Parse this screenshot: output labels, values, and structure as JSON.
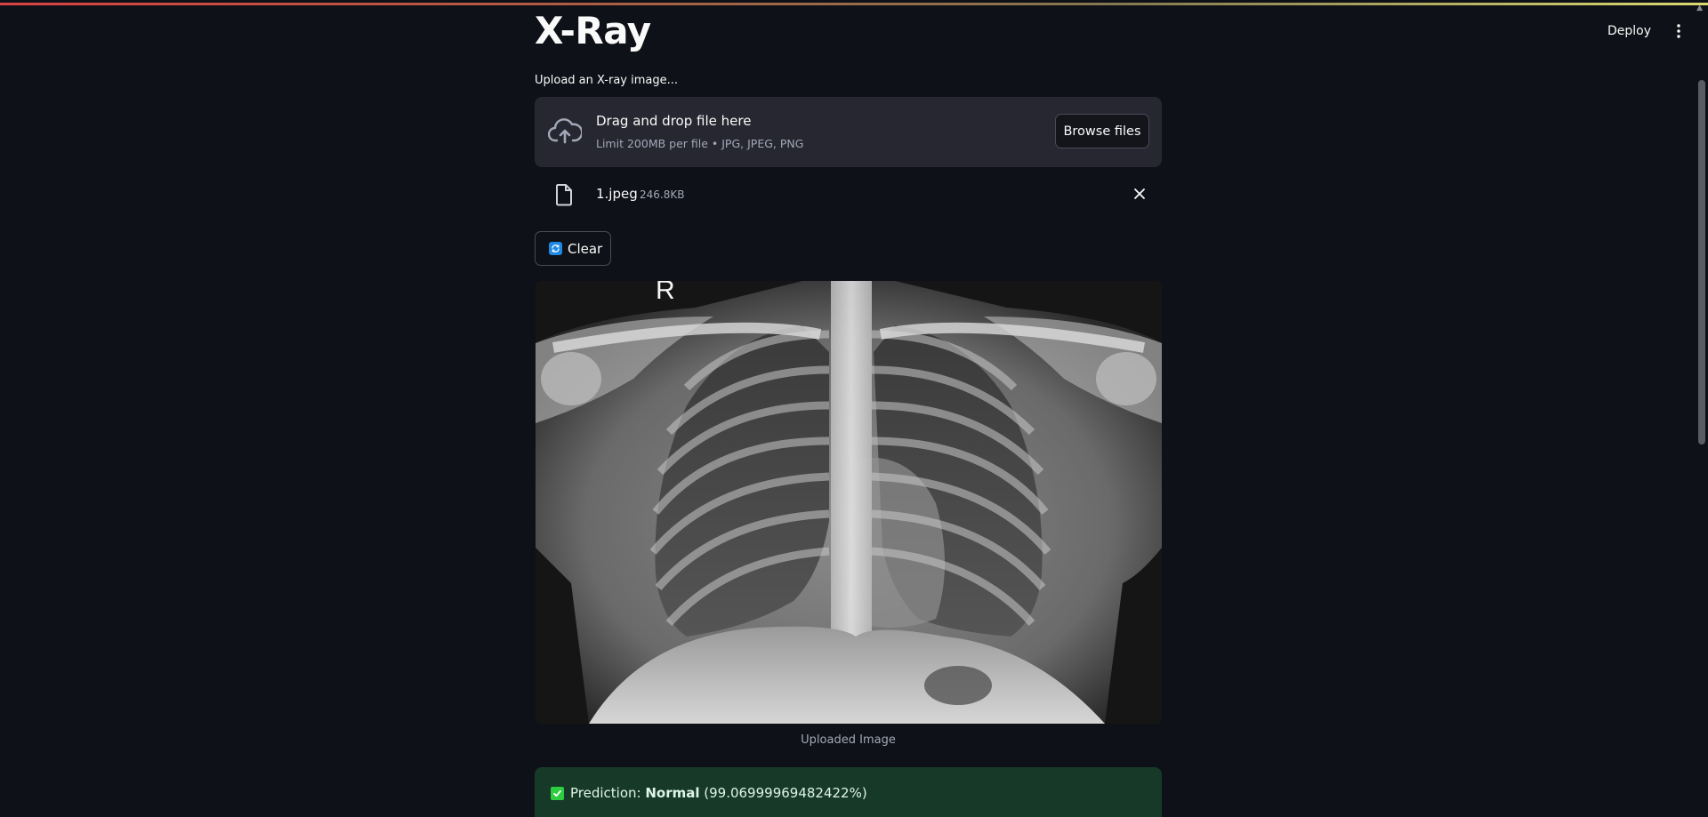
{
  "header": {
    "deploy_label": "Deploy",
    "menu_icon": "vertical-ellipsis-icon"
  },
  "main": {
    "title": "X-Ray",
    "uploader": {
      "label": "Upload an X-ray image...",
      "drop_title": "Drag and drop file here",
      "drop_subtitle": "Limit 200MB per file • JPG, JPEG, PNG",
      "browse_label": "Browse files",
      "icon": "cloud-upload-icon"
    },
    "file": {
      "name": "1.jpeg",
      "size": "246.8KB",
      "icon": "file-icon"
    },
    "clear_label": "Clear",
    "image": {
      "marker_letter": "R",
      "caption": "Uploaded Image"
    },
    "result": {
      "prefix": "Prediction: ",
      "label": "Normal",
      "confidence": " (99.06999969482422%)"
    }
  },
  "colors": {
    "background": "#0e1117",
    "dropzone": "#262730",
    "success_bg": "#173928",
    "success_text": "#dff5e6",
    "accent_blue": "#1e88e5",
    "check_green": "#2ecc40"
  }
}
